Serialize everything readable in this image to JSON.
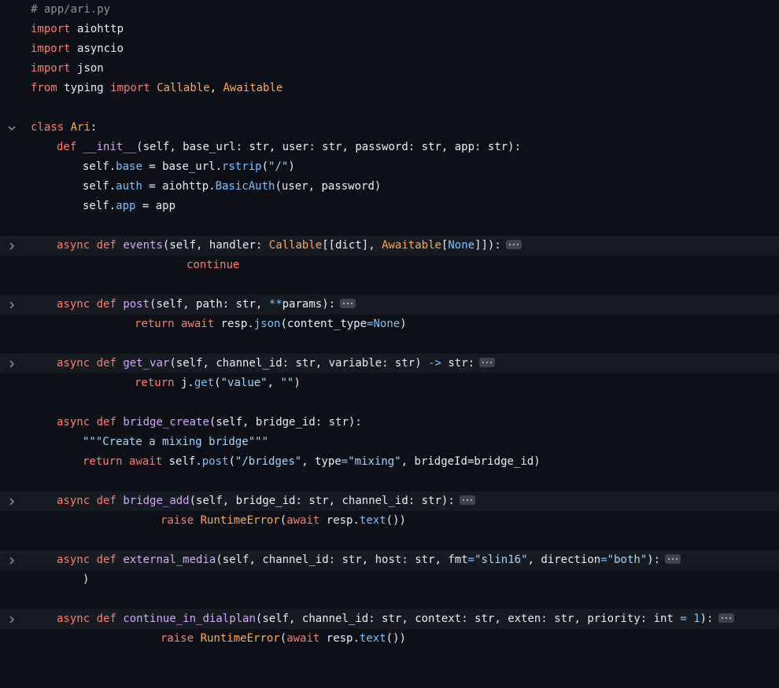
{
  "editor": {
    "file_comment": "# app/ari.py",
    "imports": {
      "kw_import": "import",
      "kw_from": "from",
      "mod_aiohttp": "aiohttp",
      "mod_asyncio": "asyncio",
      "mod_json": "json",
      "mod_typing": "typing",
      "t_callable": "Callable",
      "t_awaitable": "Awaitable"
    },
    "kw": {
      "class": "class",
      "def": "def",
      "async": "async",
      "await": "await",
      "return": "return",
      "raise": "raise",
      "continue": "continue",
      "none": "None"
    },
    "names": {
      "Ari": "Ari",
      "__init__": "__init__",
      "events": "events",
      "post": "post",
      "get_var": "get_var",
      "bridge_create": "bridge_create",
      "bridge_add": "bridge_add",
      "external_media": "external_media",
      "continue_in_dialplan": "continue_in_dialplan",
      "base": "base",
      "auth": "auth",
      "app": "app",
      "rstrip": "rstrip",
      "BasicAuth": "BasicAuth",
      "json": "json",
      "get": "get",
      "text": "text",
      "RuntimeError": "RuntimeError"
    },
    "strings": {
      "slash": "\"/\"",
      "value": "\"value\"",
      "empty": "\"\"",
      "docstring": "\"\"\"Create a mixing bridge\"\"\"",
      "bridges": "\"/bridges\"",
      "mixing": "\"mixing\"",
      "slin16": "\"slin16\"",
      "both": "\"both\""
    },
    "num_one": "1",
    "fragments": {
      "init_args": "(self, base_url: str, user: str, password: str, app: str):",
      "self": "self",
      "eq_base_url": " = base_url.",
      "paren_close": ")",
      "eq_aiohttp": " = aiohttp.",
      "user_password": "(user, password)",
      "eq_app": " = app",
      "events_args_a": "(self, handler: ",
      "events_args_b": "[[dict], ",
      "events_args_c": "]]):",
      "post_args_a": "(self, path: str, ",
      "post_stars": "**",
      "post_args_b": "params):",
      "resp_dot": " resp.",
      "content_type": "(content_type",
      "getvar_args_a": "(self, channel_id: str, variable: str) ",
      "arrow": "->",
      "getvar_args_b": " str:",
      "j_dot": " j.",
      "open_paren": "(",
      "comma_space": ", ",
      "bc_args": "(self, bridge_id: str):",
      "self_dot": " self.",
      "type_eq": ", type",
      "bridge_id_eq": ", bridgeId=bridge_id)",
      "ba_args": "(self, bridge_id: str, channel_id: str):",
      "resp_text_open": "(",
      "resp_text_tail": "())",
      "em_args_a": "(self, channel_id: str, host: str, fmt",
      "em_args_b": ", direction",
      "em_args_c": "):",
      "cid_args_a": "(self, channel_id: str, context: str, exten: str, priority: int ",
      "cid_args_b": "):",
      "eq": "=",
      "close_paren_only": ")",
      "comma": ", ",
      "colon": ":"
    }
  }
}
